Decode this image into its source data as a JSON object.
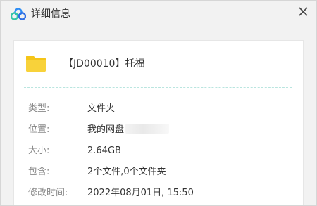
{
  "window": {
    "title": "详细信息",
    "icons": {
      "app": "cloud-logo-icon",
      "close": "close-icon",
      "folder": "folder-icon"
    },
    "colors": {
      "folder": "#F5C518",
      "logo_blue": "#2f8ef4",
      "logo_green": "#33c4a8",
      "divider": "#b9e5df"
    }
  },
  "file": {
    "name": "【JD00010】托福"
  },
  "details": [
    {
      "label": "类型:",
      "value": "文件夹"
    },
    {
      "label": "位置:",
      "value": "我的网盘"
    },
    {
      "label": "大小:",
      "value": "2.64GB"
    },
    {
      "label": "包含:",
      "value": "2个文件,0个文件夹"
    },
    {
      "label": "修改时间:",
      "value": "2022年08月01日, 15:50"
    }
  ]
}
